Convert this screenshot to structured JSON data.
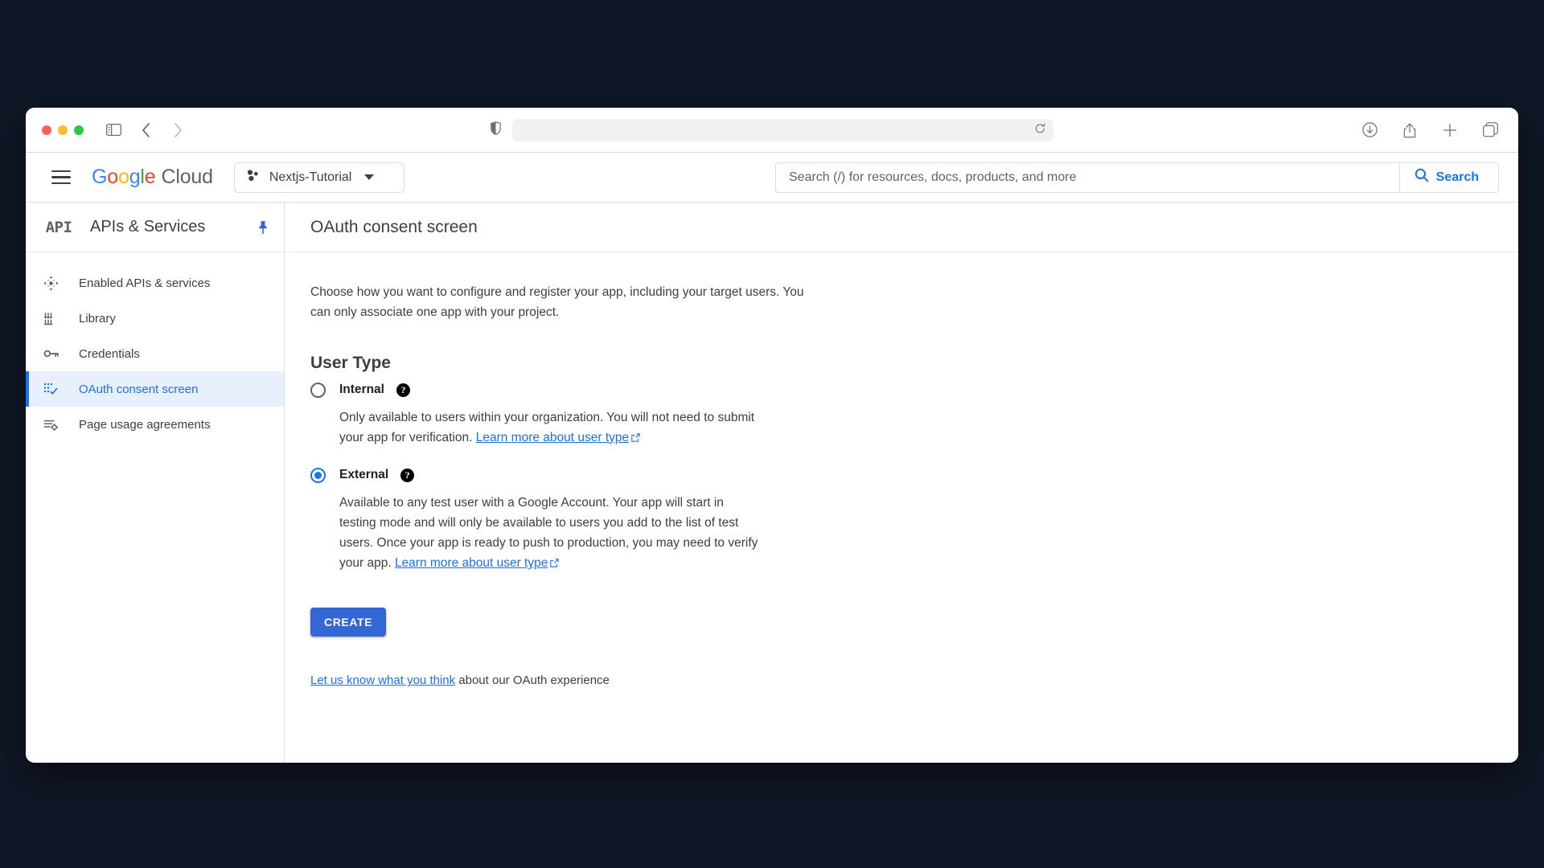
{
  "browser": {
    "traffic_lights": [
      "close",
      "minimize",
      "zoom"
    ],
    "sidebar_toggle_icon": "sidebar-toggle-icon",
    "back_icon": "chevron-left-icon",
    "forward_icon": "chevron-right-icon",
    "shield_icon": "shield-icon",
    "address_value": "",
    "address_placeholder": "",
    "reload_icon": "reload-icon",
    "downloads_icon": "download-icon",
    "share_icon": "share-icon",
    "new_tab_icon": "plus-icon",
    "tab_overview_icon": "tabs-icon"
  },
  "topbar": {
    "menu_icon": "hamburger-menu-icon",
    "logo": {
      "g1": "G",
      "o1": "o",
      "o2": "o",
      "g2": "g",
      "l": "l",
      "e": "e",
      "cloud": "Cloud"
    },
    "project": {
      "name": "Nextjs-Tutorial",
      "icon": "project-dots-icon"
    },
    "search": {
      "placeholder": "Search (/) for resources, docs, products, and more",
      "value": "",
      "button_label": "Search",
      "button_icon": "search-icon"
    }
  },
  "sidebar": {
    "badge": "API",
    "title": "APIs & Services",
    "pin_icon": "pin-icon",
    "items": [
      {
        "label": "Enabled APIs & services",
        "icon": "enabled-apis-icon",
        "active": false
      },
      {
        "label": "Library",
        "icon": "library-icon",
        "active": false
      },
      {
        "label": "Credentials",
        "icon": "key-icon",
        "active": false
      },
      {
        "label": "OAuth consent screen",
        "icon": "oauth-consent-icon",
        "active": true
      },
      {
        "label": "Page usage agreements",
        "icon": "page-usage-icon",
        "active": false
      }
    ]
  },
  "main": {
    "title": "OAuth consent screen",
    "intro": "Choose how you want to configure and register your app, including your target users. You can only associate one app with your project.",
    "section_title": "User Type",
    "options": [
      {
        "label": "Internal",
        "selected": false,
        "help_icon": "help-icon",
        "description_before_link": "Only available to users within your organization. You will not need to submit your app for verification. ",
        "link_text": "Learn more about user type",
        "link_icon": "external-link-icon",
        "description_after_link": ""
      },
      {
        "label": "External",
        "selected": true,
        "help_icon": "help-icon",
        "description_before_link": "Available to any test user with a Google Account. Your app will start in testing mode and will only be available to users you add to the list of test users. Once your app is ready to push to production, you may need to verify your app. ",
        "link_text": "Learn more about user type",
        "link_icon": "external-link-icon",
        "description_after_link": ""
      }
    ],
    "create_button": "CREATE",
    "feedback": {
      "link_text": "Let us know what you think",
      "tail_text": " about our OAuth experience"
    }
  },
  "colors": {
    "page_background": "#101827",
    "google_blue": "#1a73e8",
    "button_blue": "#3367d6",
    "active_nav_bg": "#e8f0fe",
    "text_primary": "#3c4043",
    "text_strong": "#202124"
  }
}
